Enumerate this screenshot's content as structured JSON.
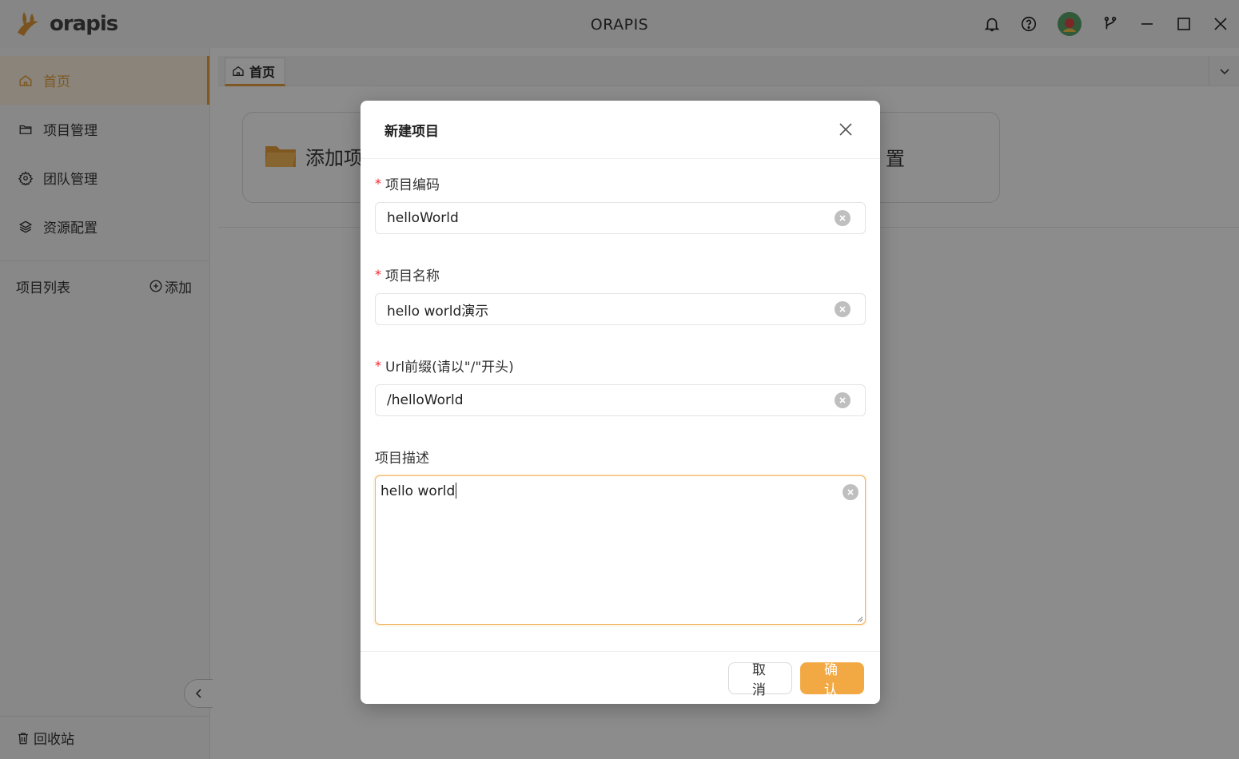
{
  "titlebar": {
    "logo_text": "orapis",
    "app_title": "ORAPIS",
    "icons": [
      "bell-icon",
      "help-icon",
      "avatar",
      "branch-icon",
      "minimize-icon",
      "maximize-icon",
      "close-icon"
    ]
  },
  "sidebar": {
    "items": [
      {
        "label": "首页",
        "icon": "home-icon"
      },
      {
        "label": "项目管理",
        "icon": "folder-icon"
      },
      {
        "label": "团队管理",
        "icon": "gear-icon"
      },
      {
        "label": "资源配置",
        "icon": "layers-icon"
      }
    ],
    "project_list_label": "项目列表",
    "add_label": "添加",
    "recycle_label": "回收站"
  },
  "tabs": {
    "home_label": "首页"
  },
  "main": {
    "add_card_label": "添加项",
    "resource_card_label": "置"
  },
  "dialog": {
    "title": "新建项目",
    "fields": {
      "code": {
        "label": "项目编码",
        "value": "helloWorld"
      },
      "name": {
        "label": "项目名称",
        "value": "hello world演示"
      },
      "url": {
        "label": "Url前缀(请以\"/\"开头)",
        "value": "/helloWorld"
      },
      "desc": {
        "label": "项目描述",
        "value": "hello world"
      }
    },
    "required_mark": "*",
    "cancel_label": "取 消",
    "ok_label": "确 认"
  },
  "colors": {
    "accent": "#f3a943",
    "required": "#f5222d"
  }
}
